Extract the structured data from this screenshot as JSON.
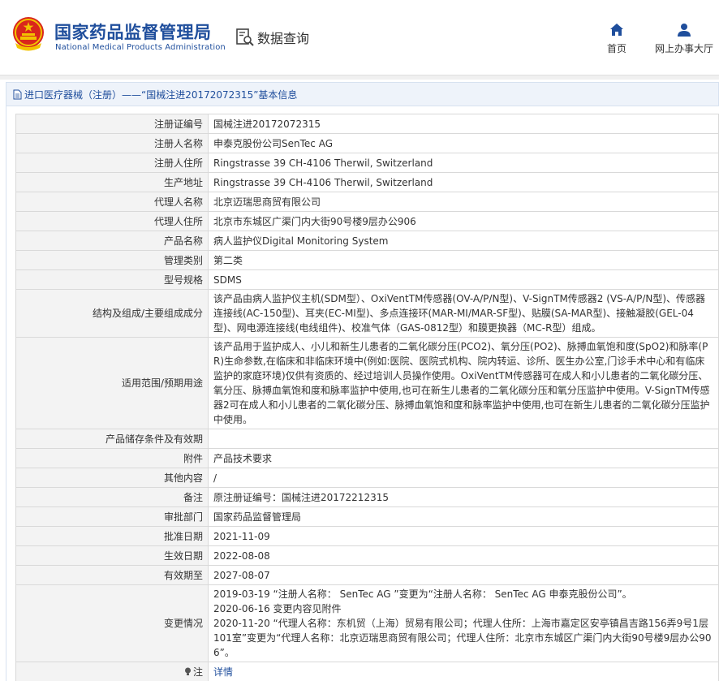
{
  "header": {
    "title_cn": "国家药品监督管理局",
    "title_en": "National Medical Products Administration",
    "emblem_icon": "national-emblem-icon",
    "query_icon": "document-search-icon",
    "query_label": "数据查询",
    "nav": {
      "home_icon": "home-icon",
      "home_label": "首页",
      "hall_icon": "user-icon",
      "hall_label": "网上办事大厅"
    }
  },
  "breadcrumb": {
    "icon": "document-icon",
    "text": "进口医疗器械（注册）——“国械注进20172072315”基本信息"
  },
  "rows": [
    {
      "label": "注册证编号",
      "value": "国械注进20172072315"
    },
    {
      "label": "注册人名称",
      "value": "申泰克股份公司SenTec AG"
    },
    {
      "label": "注册人住所",
      "value": "Ringstrasse 39 CH-4106 Therwil, Switzerland"
    },
    {
      "label": "生产地址",
      "value": "Ringstrasse 39 CH-4106 Therwil, Switzerland"
    },
    {
      "label": "代理人名称",
      "value": "北京迈瑞思商贸有限公司"
    },
    {
      "label": "代理人住所",
      "value": "北京市东城区广渠门内大街90号楼9层办公906"
    },
    {
      "label": "产品名称",
      "value": "病人监护仪Digital Monitoring System"
    },
    {
      "label": "管理类别",
      "value": "第二类"
    },
    {
      "label": "型号规格",
      "value": "SDMS"
    },
    {
      "label": "结构及组成/主要组成成分",
      "value": "该产品由病人监护仪主机(SDM型）、OxiVentTM传感器(OV-A/P/N型)、V-SignTM传感器2 (VS-A/P/N型)、传感器连接线(AC-150型)、耳夹(EC-MI型)、多点连接环(MAR-MI/MAR-SF型)、贴膜(SA-MAR型)、接触凝胶(GEL-04型)、网电源连接线(电线组件)、校准气体（GAS-0812型）和膜更换器（MC-R型）组成。"
    },
    {
      "label": "适用范围/预期用途",
      "value": "该产品用于监护成人、小儿和新生儿患者的二氧化碳分压(PCO2)、氧分压(PO2)、脉搏血氧饱和度(SpO2)和脉率(PR)生命参数,在临床和非临床环境中(例如:医院、医院式机构、院内转运、诊所、医生办公室,门诊手术中心和有临床监护的家庭环境)仅供有资质的、经过培训人员操作使用。OxiVentTM传感器可在成人和小儿患者的二氧化碳分压、氧分压、脉搏血氧饱和度和脉率监护中使用,也可在新生儿患者的二氧化碳分压和氧分压监护中使用。V-SignTM传感器2可在成人和小儿患者的二氧化碳分压、脉搏血氧饱和度和脉率监护中使用,也可在新生儿患者的二氧化碳分压监护中使用。"
    },
    {
      "label": "产品储存条件及有效期",
      "value": ""
    },
    {
      "label": "附件",
      "value": "产品技术要求"
    },
    {
      "label": "其他内容",
      "value": "/"
    },
    {
      "label": "备注",
      "value": "原注册证编号：国械注进20172212315"
    },
    {
      "label": "审批部门",
      "value": "国家药品监督管理局"
    },
    {
      "label": "批准日期",
      "value": "2021-11-09"
    },
    {
      "label": "生效日期",
      "value": "2022-08-08"
    },
    {
      "label": "有效期至",
      "value": "2027-08-07"
    }
  ],
  "changes": {
    "label": "变更情况",
    "lines": [
      "2019-03-19 “注册人名称： SenTec AG ”变更为“注册人名称： SenTec AG 申泰克股份公司”。",
      "2020-06-16 变更内容见附件",
      "2020-11-20 “代理人名称：东机贸（上海）贸易有限公司；代理人住所：上海市嘉定区安亭镇昌吉路156弄9号1层101室”变更为“代理人名称：北京迈瑞思商贸有限公司；代理人住所：北京市东城区广渠门内大街90号楼9层办公906”。"
    ]
  },
  "note": {
    "icon": "lightbulb-icon",
    "label": "注",
    "link": "详情"
  }
}
